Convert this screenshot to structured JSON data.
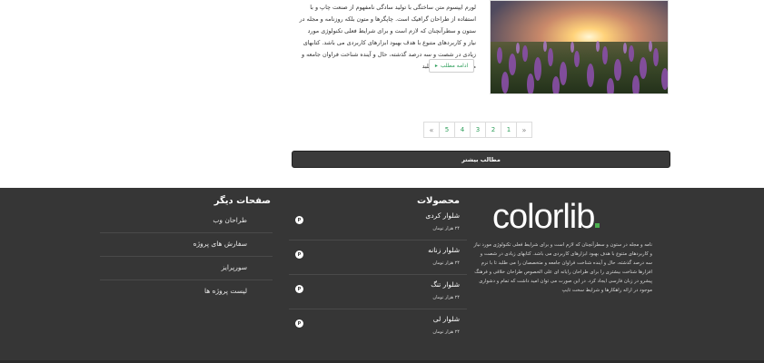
{
  "post": {
    "excerpt": "لورم ایپسوم متن ساختگی با تولید سادگی نامفهوم از صنعت چاپ و با استفاده از طراحان گرافیک است. چاپگرها و متون بلکه روزنامه و مجله در ستون و سطرآنچنان که لازم است و برای شرایط فعلی تکنولوژی مورد نیاز و کاربردهای متنوع با هدف بهبود ابزارهای کاربردی می باشد. کتابهای زیادی در شصت و سه درصد گذشته، حال و آینده شناخت فراوان جامعه و متخصصان را می طلبد",
    "read_more_label": "ادامه مطلب",
    "read_more_icon": "chevron-right-icon",
    "image_alt": "purple lavender field at sunset"
  },
  "pagination": {
    "prev": "«",
    "pages": [
      "5",
      "4",
      "3",
      "2",
      "1"
    ],
    "next": "»"
  },
  "more_posts_label": "مطالب بیشتر",
  "footer": {
    "brand": {
      "logo_text": "colorlib",
      "description": "نامه و مجله در ستون و سطرآنچنان که لازم است و برای شرایط فعلی تکنولوژی مورد نیاز و کاربردهای متنوع با هدف بهبود ابزارهای کاربردی می باشد. کتابهای زیادی در شصت و سه درصد گذشته، حال و آینده شناخت فراوان جامعه و متخصصان را می طلبد تا با نرم افزارها شناخت بیشتری را برای طراحان رایانه ای علی الخصوص طراحان خلاقی و فرهنگ پیشرو در زبان فارسی ایجاد کرد. در این صورت می توان امید داشت که تمام و دشواری موجود در ارائه راهکارها و شرایط سخت تایپ"
    },
    "products": {
      "heading": "محصولات",
      "items": [
        {
          "name": "شلوار کردی",
          "price": "۲۴ هزار تومان",
          "icon": "P"
        },
        {
          "name": "شلوار زنانه",
          "price": "۲۴ هزار تومان",
          "icon": "P"
        },
        {
          "name": "شلوار تنگ",
          "price": "۲۴ هزار تومان",
          "icon": "P"
        },
        {
          "name": "شلوار لی",
          "price": "۲۴ هزار تومان",
          "icon": "P"
        }
      ]
    },
    "pages": {
      "heading": "صفحات دیگر",
      "items": [
        "طراحان وب",
        "سفارش های پروژه",
        "سورپرایز",
        "لیست پروژه ها"
      ]
    },
    "colors": {
      "background": "#363636",
      "accent": "#4caf50",
      "link": "#2d9e5a"
    }
  }
}
